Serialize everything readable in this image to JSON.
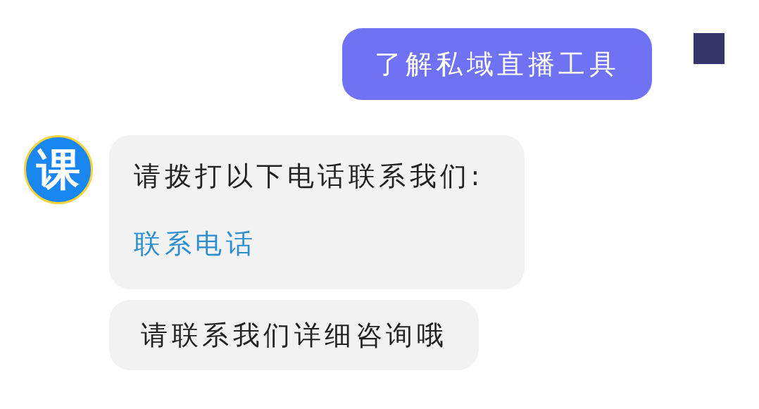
{
  "user_message": {
    "text": "了解私域直播工具"
  },
  "bot_avatar": {
    "text": "课"
  },
  "bot_messages": [
    {
      "kind": "contact",
      "text": "请拨打以下电话联系我们:",
      "link": "联系电话"
    },
    {
      "kind": "text",
      "text": "请联系我们详细咨询哦"
    }
  ]
}
